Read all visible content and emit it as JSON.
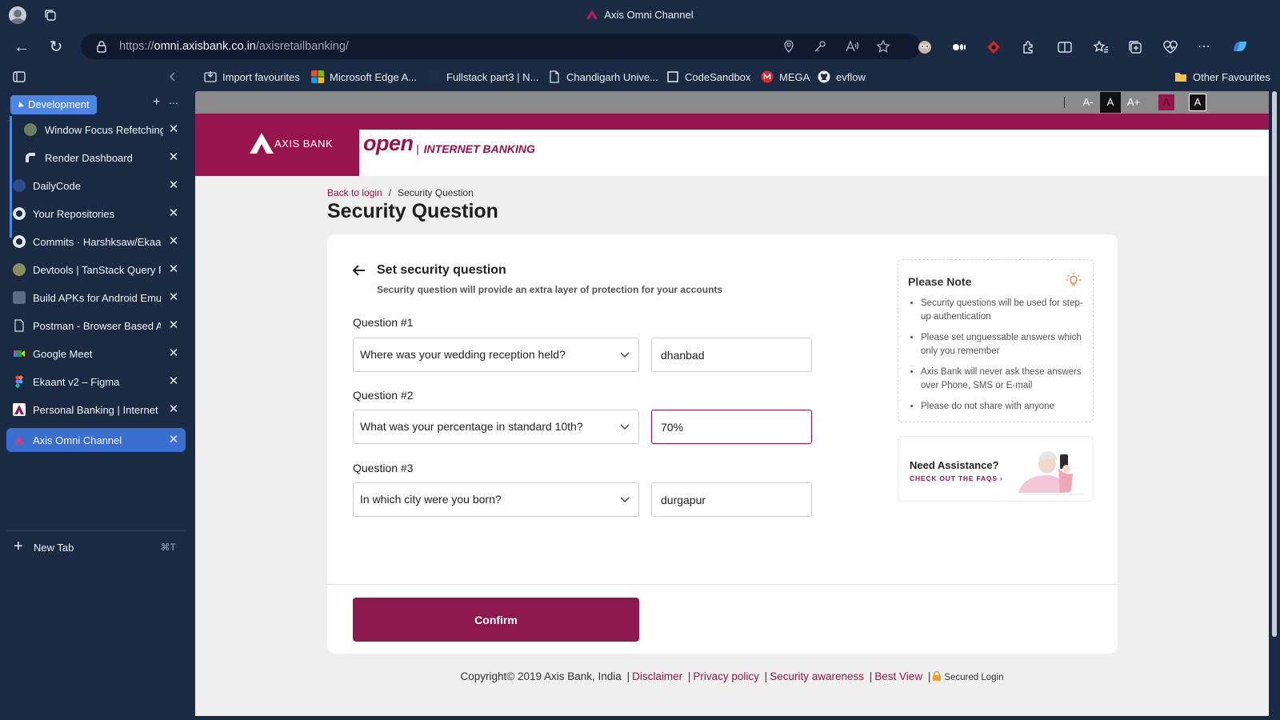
{
  "window": {
    "title": "Axis Omni Channel"
  },
  "address": {
    "url_prefix": "https://",
    "url_host": "omni.axisbank.co.in",
    "url_path": "/axisretailbanking/"
  },
  "favourites": [
    {
      "label": "Import favourites"
    },
    {
      "label": "Microsoft Edge A..."
    },
    {
      "label": "Fullstack part3 | N..."
    },
    {
      "label": "Chandigarh Unive..."
    },
    {
      "label": "CodeSandbox"
    },
    {
      "label": "MEGA"
    },
    {
      "label": "evflow"
    }
  ],
  "other_favourites": "Other Favourites",
  "sidebar": {
    "group_label": "Development",
    "group_tabs": [
      {
        "label": "Window Focus Refetching"
      },
      {
        "label": "Render Dashboard"
      }
    ],
    "tabs": [
      {
        "label": "DailyCode"
      },
      {
        "label": "Your Repositories"
      },
      {
        "label": "Commits · Harshksaw/Ekaant"
      },
      {
        "label": "Devtools | TanStack Query React"
      },
      {
        "label": "Build APKs for Android Emulators"
      },
      {
        "label": "Postman - Browser Based API"
      },
      {
        "label": "Google Meet"
      },
      {
        "label": "Ekaant v2 – Figma"
      },
      {
        "label": "Personal Banking | Internet Banking"
      },
      {
        "label": "Axis Omni Channel"
      }
    ],
    "new_tab_label": "New Tab",
    "new_tab_shortcut": "⌘T"
  },
  "accessibility": {
    "decrease": "A-",
    "normal": "A",
    "increase": "A+",
    "theme_red": "A",
    "theme_dark": "A"
  },
  "brand": {
    "bank": "AXIS BANK",
    "open": "open",
    "sep": "|",
    "product": "INTERNET BANKING"
  },
  "breadcrumb": {
    "back": "Back to login",
    "sep": "/",
    "current": "Security Question"
  },
  "page_title": "Security Question",
  "card": {
    "heading": "Set security question",
    "subheading": "Security question will provide an extra layer of protection for your accounts",
    "questions": [
      {
        "label": "Question #1",
        "question": "Where was your wedding reception held?",
        "answer": "dhanbad"
      },
      {
        "label": "Question #2",
        "question": "What was your percentage in standard 10th?",
        "answer": "70%"
      },
      {
        "label": "Question #3",
        "question": "In which city were you born?",
        "answer": "durgapur"
      }
    ],
    "confirm_label": "Confirm"
  },
  "note": {
    "title": "Please Note",
    "items": [
      "Security questions will be used for step-up authentication",
      "Please set unguessable answers which only you remember",
      "Axis Bank will never ask these answers over Phone, SMS or E-mail",
      "Please do not share with anyone"
    ]
  },
  "assist": {
    "title": "Need Assistance?",
    "link": "CHECK OUT THE FAQS ›"
  },
  "footer": {
    "copyright": "Copyright© 2019 Axis Bank, India",
    "links": [
      "Disclaimer",
      "Privacy policy",
      "Security awareness",
      "Best View"
    ],
    "secured": "Secured Login"
  },
  "colors": {
    "brand": "#97144d",
    "chrome": "#1b2a43",
    "active_tab": "#3a6fd0",
    "group": "#4b86e6"
  }
}
